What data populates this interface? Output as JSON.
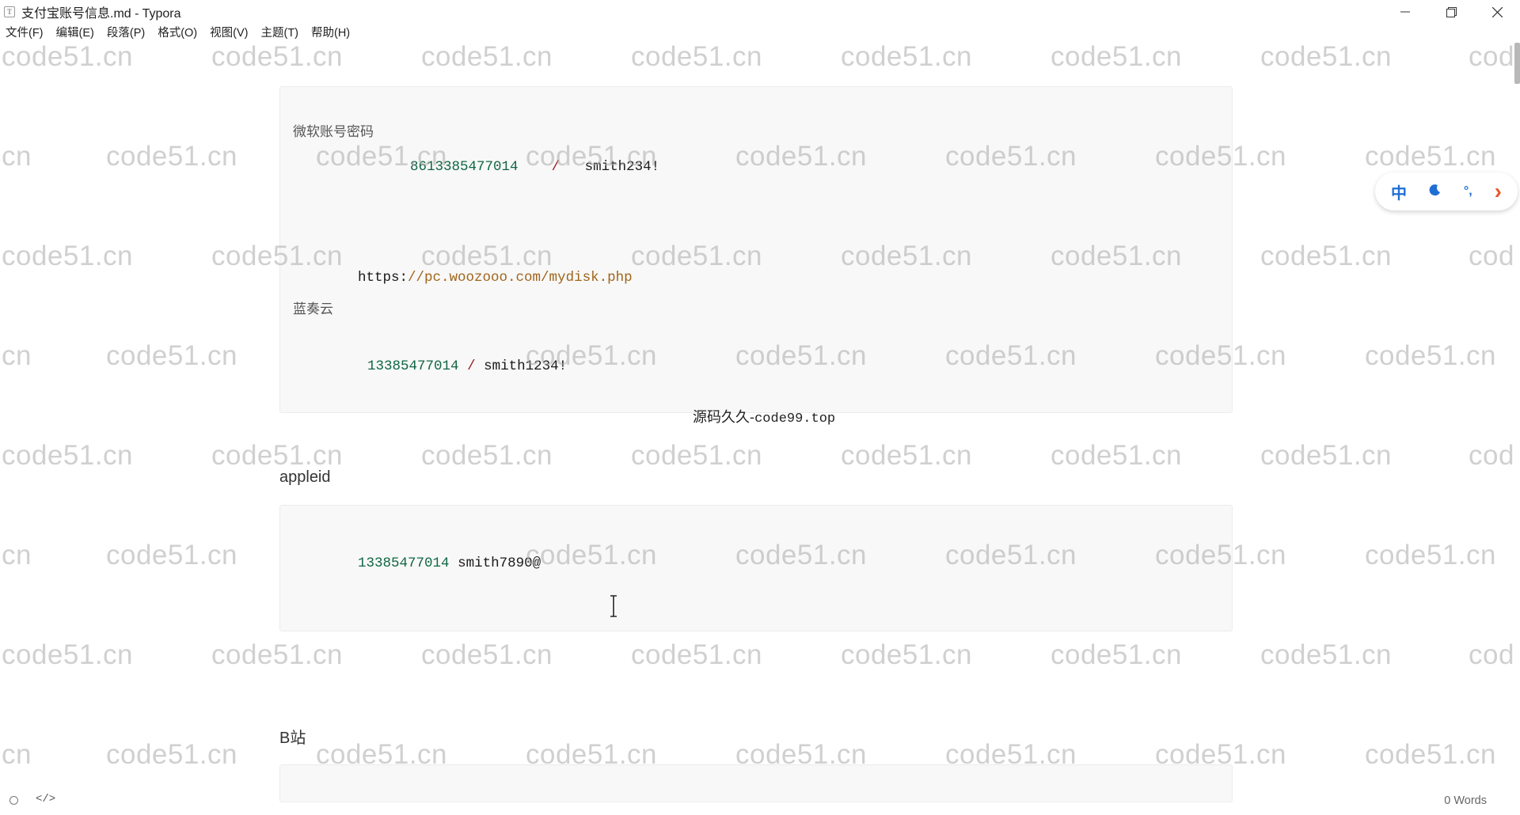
{
  "window": {
    "title": "支付宝账号信息.md - Typora",
    "app_icon_glyph": "T"
  },
  "menu": [
    {
      "label": "文件(F)"
    },
    {
      "label": "编辑(E)"
    },
    {
      "label": "段落(P)"
    },
    {
      "label": "格式(O)"
    },
    {
      "label": "视图(V)"
    },
    {
      "label": "主题(T)"
    },
    {
      "label": "帮助(H)"
    }
  ],
  "watermark": "code51.cn",
  "watermark_partial_left": "cn",
  "watermark_partial_right": "cod",
  "document": {
    "block1": {
      "label_ms": "微软账号密码",
      "ms_phone": "8613385477014",
      "ms_sep": "/",
      "ms_password": "smith234!",
      "url_scheme": "https:",
      "url_rest": "//pc.woozooo.com/mydisk.php",
      "label_lanzou": "蓝奏云",
      "lz_phone": "13385477014",
      "lz_sep": "/",
      "lz_password": "smith1234!"
    },
    "center_note_cjk": "源码久久-",
    "center_note_mono": "code99.top",
    "heading_appleid": "appleid",
    "block2": {
      "phone": "13385477014",
      "password": "smith7890@"
    },
    "heading_bilibili": "B站"
  },
  "ime": {
    "lang": "中",
    "moon_icon": "moon-icon",
    "punct": "°,",
    "arrow": "›"
  },
  "status": {
    "word_count": "0 Words",
    "code_toggle": "</>"
  }
}
